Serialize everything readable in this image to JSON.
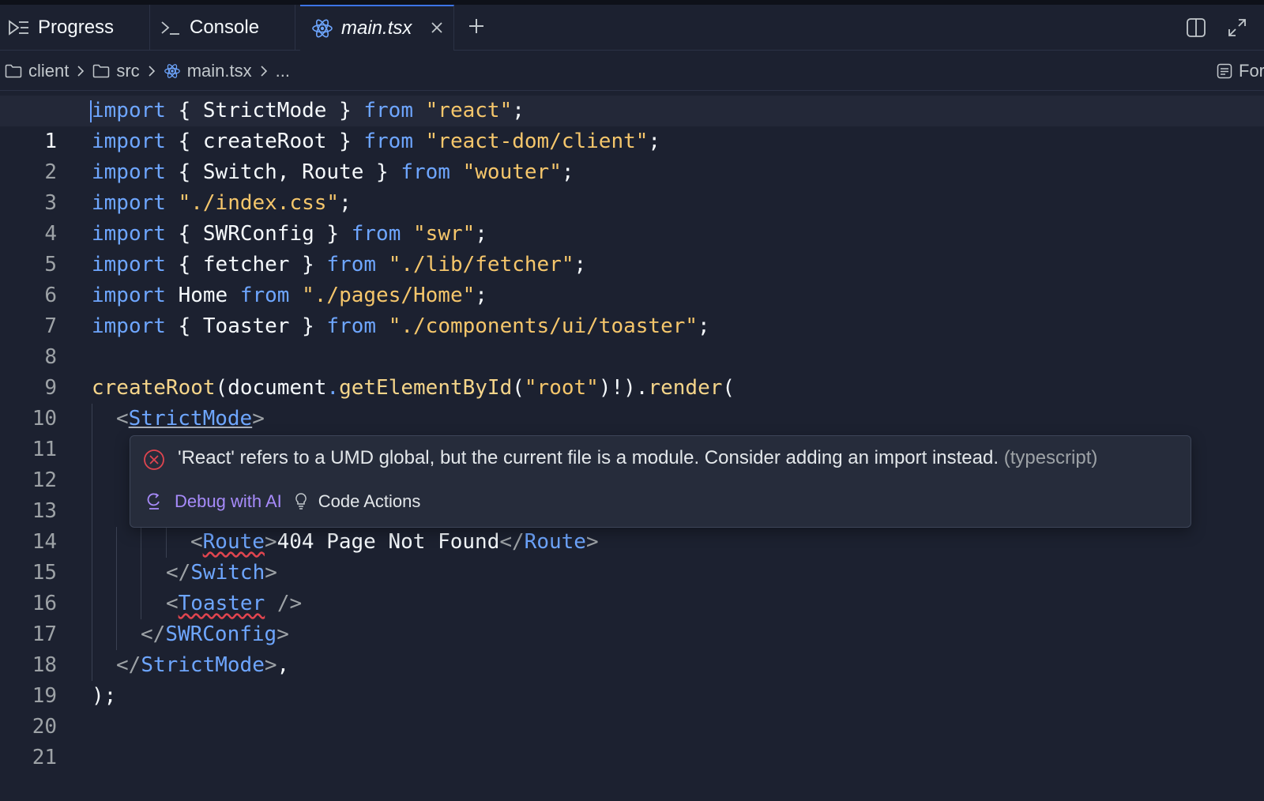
{
  "tabs": [
    {
      "label": "Progress",
      "icon": "progress-icon",
      "active": false
    },
    {
      "label": "Console",
      "icon": "console-icon",
      "active": false
    },
    {
      "label": "main.tsx",
      "icon": "react-icon",
      "active": true
    }
  ],
  "breadcrumb": {
    "items": [
      "client",
      "src",
      "main.tsx",
      "..."
    ],
    "right_label": "For"
  },
  "editor": {
    "current_line": 1,
    "line_numbers": [
      "1",
      "2",
      "3",
      "4",
      "5",
      "6",
      "7",
      "8",
      "9",
      "10",
      "11",
      "12",
      "13",
      "14",
      "15",
      "16",
      "17",
      "18",
      "19",
      "20",
      "21"
    ],
    "lines": {
      "l1": {
        "a": "import",
        "b": " { StrictMode } ",
        "c": "from",
        "d": " ",
        "e": "\"react\"",
        "f": ";"
      },
      "l2": {
        "a": "import",
        "b": " { createRoot } ",
        "c": "from",
        "d": " ",
        "e": "\"react-dom/client\"",
        "f": ";"
      },
      "l3": {
        "a": "import",
        "b": " { Switch, Route } ",
        "c": "from",
        "d": " ",
        "e": "\"wouter\"",
        "f": ";"
      },
      "l4": {
        "a": "import",
        "b": " ",
        "e": "\"./index.css\"",
        "f": ";"
      },
      "l5": {
        "a": "import",
        "b": " { SWRConfig } ",
        "c": "from",
        "d": " ",
        "e": "\"swr\"",
        "f": ";"
      },
      "l6": {
        "a": "import",
        "b": " { fetcher } ",
        "c": "from",
        "d": " ",
        "e": "\"./lib/fetcher\"",
        "f": ";"
      },
      "l7": {
        "a": "import",
        "b": " Home ",
        "c": "from",
        "d": " ",
        "e": "\"./pages/Home\"",
        "f": ";"
      },
      "l8": {
        "a": "import",
        "b": " { Toaster } ",
        "c": "from",
        "d": " ",
        "e": "\"./components/ui/toaster\"",
        "f": ";"
      },
      "l10": {
        "fn1": "createRoot",
        "p1": "(document",
        "dot1": ".",
        "fn2": "getElementById",
        "p2": "(",
        "s": "\"root\"",
        "p3": ")!).",
        "fn3": "render",
        "p4": "("
      },
      "l11": {
        "lt": "<",
        "tag": "StrictMode",
        "gt": ">"
      },
      "l15": {
        "lt": "<",
        "tag": "Route",
        "gt": ">",
        "text": "404 Page Not Found",
        "lt2": "</",
        "tag2": "Route",
        "gt2": ">"
      },
      "l16": {
        "lt": "</",
        "tag": "Switch",
        "gt": ">"
      },
      "l17": {
        "lt": "<",
        "tag": "Toaster",
        "gt": " />"
      },
      "l18": {
        "lt": "</",
        "tag": "SWRConfig",
        "gt": ">"
      },
      "l19": {
        "lt": "</",
        "tag": "StrictMode",
        "gt": ">",
        "p": ","
      },
      "l20": {
        "p": ");"
      }
    }
  },
  "hover": {
    "message": "'React' refers to a UMD global, but the current file is a module. Consider adding an import instead.",
    "source": "(typescript)",
    "debug_label": "Debug with AI",
    "code_actions_label": "Code Actions"
  },
  "colors": {
    "accent": "#3c74e6",
    "keyword": "#6ea6ff",
    "string": "#f5c66b",
    "error": "#e0454f",
    "ai": "#a78bfa"
  }
}
